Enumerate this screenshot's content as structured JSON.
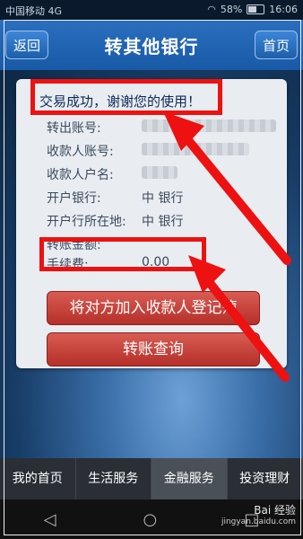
{
  "status_bar": {
    "carrier": "中国移动 4G",
    "battery": "58%",
    "time": "16:06"
  },
  "header": {
    "title": "转其他银行",
    "back_label": "返回",
    "home_label": "首页"
  },
  "result": {
    "success_message": "交易成功，谢谢您的使用！",
    "fields": [
      {
        "label": "转出账号:",
        "value": ""
      },
      {
        "label": "收款人账号:",
        "value": ""
      },
      {
        "label": "收款人户名:",
        "value": ""
      },
      {
        "label": "开户银行:",
        "value": "中        银行"
      },
      {
        "label": "开户行所在地:",
        "value": "中        银行"
      },
      {
        "label": "转账金额:",
        "value": ""
      },
      {
        "label": "手续费:",
        "value": "0.00"
      }
    ],
    "add_payee_button": "将对方加入收款人登记簿",
    "query_button": "转账查询"
  },
  "tabs": [
    "我的首页",
    "生活服务",
    "金融服务",
    "投资理财"
  ],
  "active_tab": "金融服务",
  "watermark": {
    "brand": "Bai 经验",
    "url": "jingyan.baidu.com"
  },
  "colors": {
    "header": "#185aa6",
    "button_red": "#b5302a",
    "annotation": "#ee1111"
  }
}
